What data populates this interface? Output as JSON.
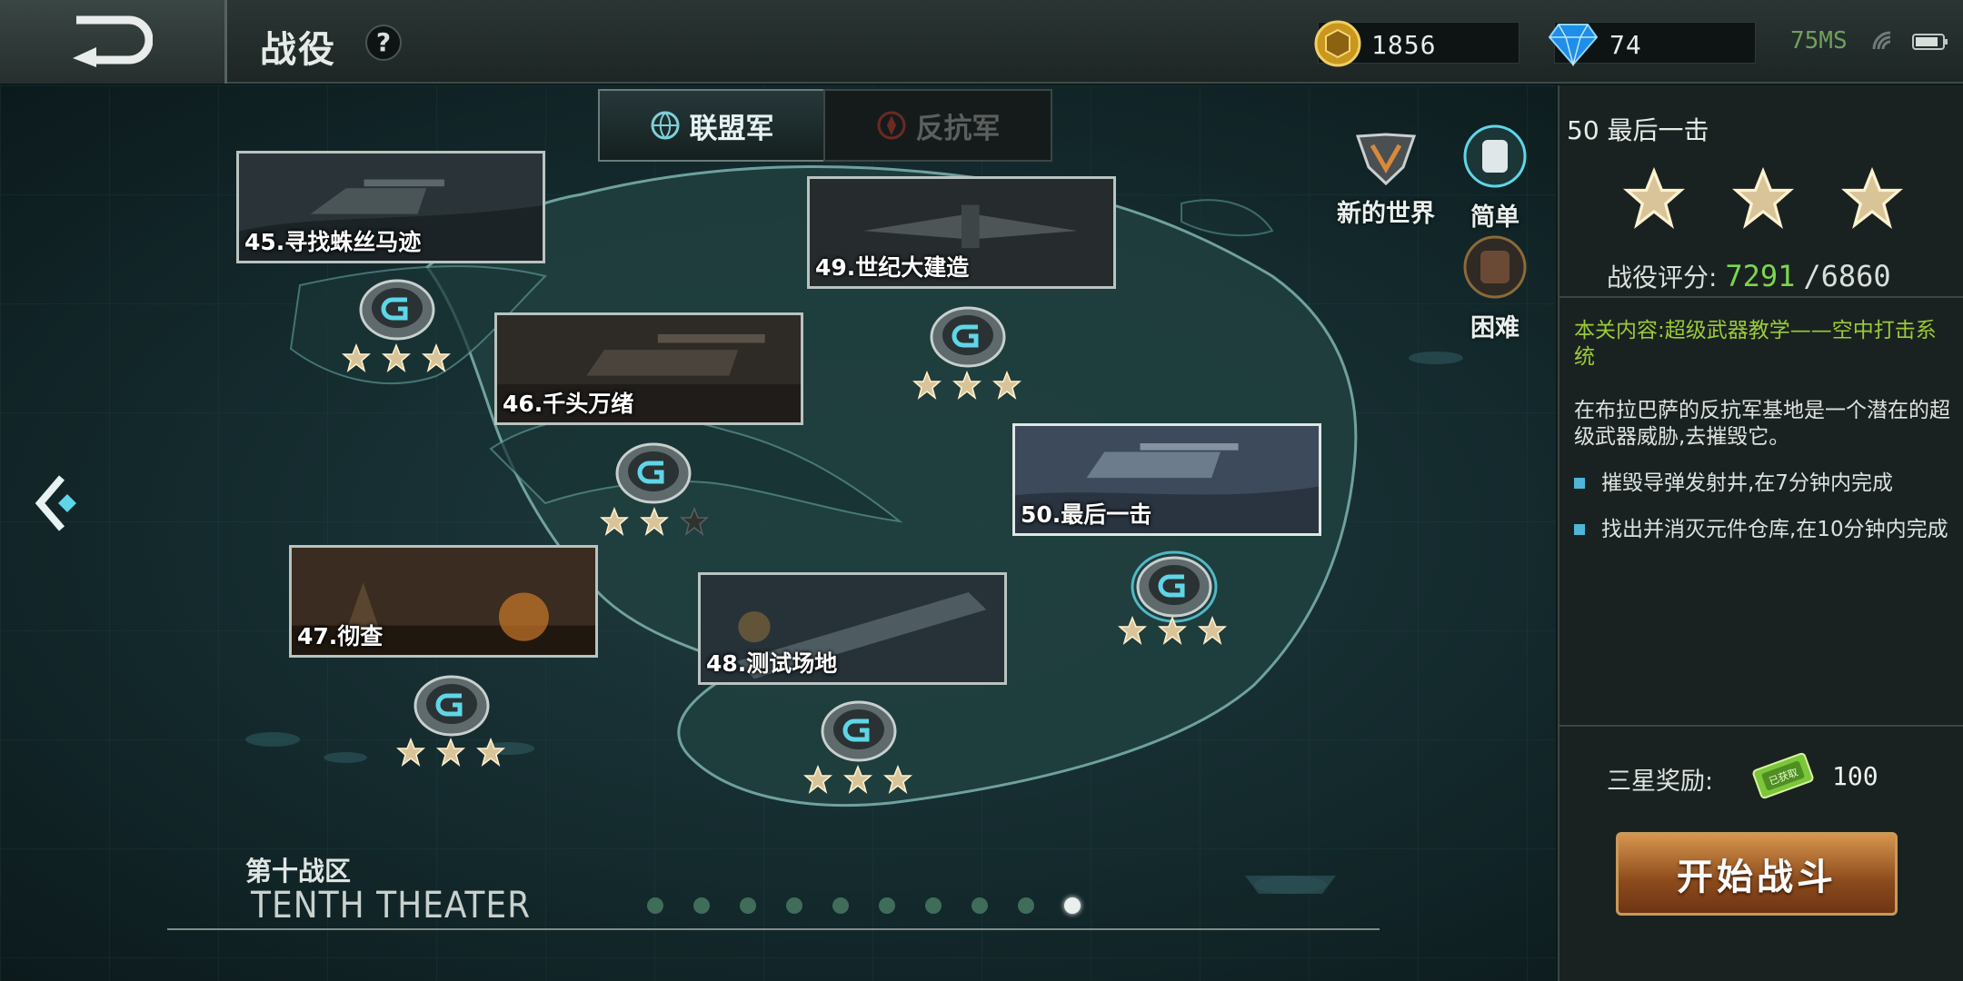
{
  "header": {
    "title": "战役",
    "help": "?",
    "gold": "1856",
    "gems": "74",
    "ping": "75MS"
  },
  "factions": [
    {
      "label": "联盟军",
      "active": true
    },
    {
      "label": "反抗军",
      "active": false
    }
  ],
  "missions": [
    {
      "label": "45.寻找蛛丝马迹",
      "stars": 3
    },
    {
      "label": "46.千头万绪",
      "stars": 2
    },
    {
      "label": "47.彻查",
      "stars": 3
    },
    {
      "label": "48.测试场地",
      "stars": 3
    },
    {
      "label": "49.世纪大建造",
      "stars": 3
    },
    {
      "label": "50.最后一击",
      "stars": 3,
      "selected": true
    }
  ],
  "side_buttons": {
    "new_world": "新的世界",
    "easy": "简单",
    "hard": "困难"
  },
  "panel": {
    "mission_title": "50 最后一击",
    "stars": 3,
    "rating_label": "战役评分:",
    "rating_value": "7291",
    "rating_max": "/6860",
    "content_title": "本关内容:超级武器教学——空中打击系统",
    "description": "在布拉巴萨的反抗军基地是一个潜在的超级武器威胁,去摧毁它。",
    "objectives": [
      "摧毁导弹发射井,在7分钟内完成",
      "找出并消灭元件仓库,在10分钟内完成"
    ],
    "reward_label": "三星奖励:",
    "reward_value": "100",
    "reward_badge": "已获取",
    "start_button": "开始战斗"
  },
  "theater": {
    "title_cn": "第十战区",
    "title_en": "TENTH THEATER",
    "page_count": 10,
    "current_page": 10
  },
  "colors": {
    "rating": "#7cd64f",
    "objective_text": "#9acb38",
    "start_button": "#c0703a",
    "active_dot": "#e9efec"
  }
}
